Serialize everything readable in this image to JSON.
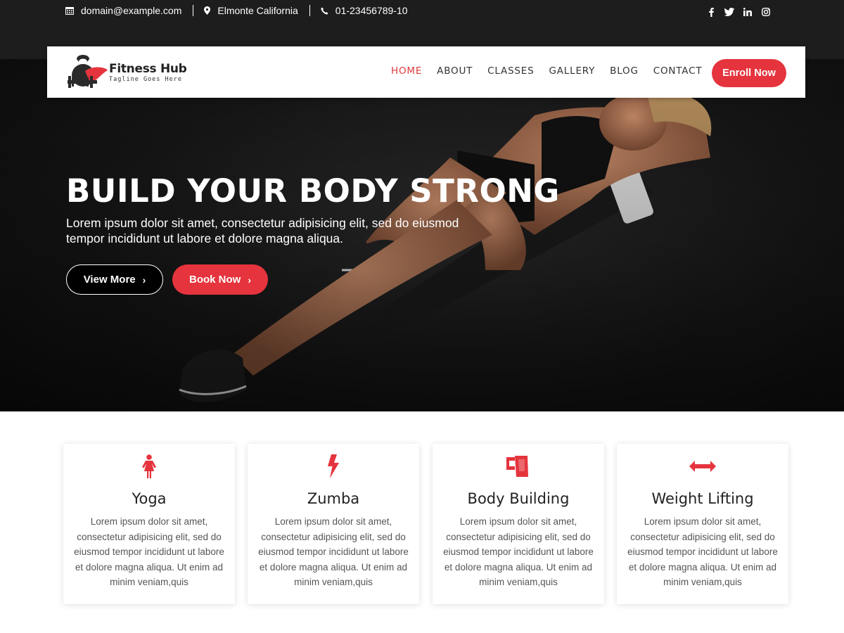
{
  "topbar": {
    "email": "domain@example.com",
    "location": "Elmonte California",
    "phone": "01-23456789-10",
    "socials": [
      "facebook-icon",
      "twitter-icon",
      "linkedin-icon",
      "instagram-icon"
    ]
  },
  "header": {
    "logo_name": "Fitness Hub",
    "logo_tagline": "Tagline Goes Here",
    "nav": [
      "HOME",
      "ABOUT",
      "CLASSES",
      "GALLERY",
      "BLOG",
      "CONTACT"
    ],
    "active_nav": "HOME",
    "enroll_label": "Enroll Now"
  },
  "hero": {
    "title": "BUILD YOUR BODY STRONG",
    "subtitle": "Lorem ipsum dolor sit amet, consectetur adipisicing elit, sed do eiusmod tempor incididunt ut labore et dolore magna aliqua.",
    "view_more_label": "View More",
    "book_now_label": "Book Now"
  },
  "features": [
    {
      "title": "Yoga",
      "icon": "female-figure-icon",
      "text": "Lorem ipsum dolor sit amet, consectetur adipisicing elit, sed do eiusmod tempor incididunt ut labore et dolore magna aliqua. Ut enim ad minim veniam,quis"
    },
    {
      "title": "Zumba",
      "icon": "bolt-icon",
      "text": "Lorem ipsum dolor sit amet, consectetur adipisicing elit, sed do eiusmod tempor incididunt ut labore et dolore magna aliqua. Ut enim ad minim veniam,quis"
    },
    {
      "title": "Body Building",
      "icon": "mug-icon",
      "text": "Lorem ipsum dolor sit amet, consectetur adipisicing elit, sed do eiusmod tempor incididunt ut labore et dolore magna aliqua. Ut enim ad minim veniam,quis"
    },
    {
      "title": "Weight Lifting",
      "icon": "arrows-horizontal-icon",
      "text": "Lorem ipsum dolor sit amet, consectetur adipisicing elit, sed do eiusmod tempor incididunt ut labore et dolore magna aliqua. Ut enim ad minim veniam,quis"
    }
  ],
  "colors": {
    "accent": "#e5343d",
    "topbar_bg": "#1d1d1d",
    "text_dark": "#222222",
    "text_body": "#555555"
  }
}
